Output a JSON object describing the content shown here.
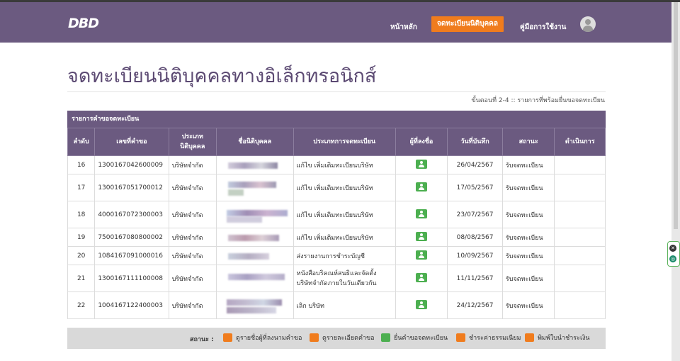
{
  "nav": {
    "logo": "DBD",
    "home": "หน้าหลัก",
    "register": "จดทะเบียนนิติบุคคล",
    "manual": "คู่มือการใช้งาน"
  },
  "page": {
    "title": "จดทะเบียนนิติบุคคลทางอิเล็กทรอนิกส์",
    "step": "ขั้นตอนที่ 2-4 :: รายการที่พร้อมยื่นขอจดทะเบียน"
  },
  "panel": {
    "title": "รายการคำขอจดทะเบียน",
    "headers": {
      "no": "ลำดับ",
      "request_no": "เลขที่คำขอ",
      "entity_type": "ประเภท นิติบุคคล",
      "entity_name": "ชื่อนิติบุคคล",
      "registration_type": "ประเภทการจดทะเบียน",
      "signer": "ผู้ที่ลงชื่อ",
      "saved_date": "วันที่บันทึก",
      "status": "สถานะ",
      "action": "ดำเนินการ"
    },
    "rows": [
      {
        "no": "16",
        "request_no": "1300167042600009",
        "entity_type": "บริษัทจำกัด",
        "registration_type": "แก้ไข เพิ่มเติมทะเบียนบริษัท",
        "saved_date": "26/04/2567",
        "status": "รับจดทะเบียน"
      },
      {
        "no": "17",
        "request_no": "1300167051700012",
        "entity_type": "บริษัทจำกัด",
        "registration_type": "แก้ไข เพิ่มเติมทะเบียนบริษัท",
        "saved_date": "17/05/2567",
        "status": "รับจดทะเบียน"
      },
      {
        "no": "18",
        "request_no": "4000167072300003",
        "entity_type": "บริษัทจำกัด",
        "registration_type": "แก้ไข เพิ่มเติมทะเบียนบริษัท",
        "saved_date": "23/07/2567",
        "status": "รับจดทะเบียน"
      },
      {
        "no": "19",
        "request_no": "7500167080800002",
        "entity_type": "บริษัทจำกัด",
        "registration_type": "แก้ไข เพิ่มเติมทะเบียนบริษัท",
        "saved_date": "08/08/2567",
        "status": "รับจดทะเบียน"
      },
      {
        "no": "20",
        "request_no": "1084167091000016",
        "entity_type": "บริษัทจำกัด",
        "registration_type": "ส่งรายงานการชำระบัญชี",
        "saved_date": "10/09/2567",
        "status": "รับจดทะเบียน"
      },
      {
        "no": "21",
        "request_no": "1300167111100008",
        "entity_type": "บริษัทจำกัด",
        "registration_type": "หนังสือบริคณห์สนธิและจัดตั้งบริษัทจำกัดภายในวันเดียวกัน",
        "saved_date": "11/11/2567",
        "status": "รับจดทะเบียน"
      },
      {
        "no": "22",
        "request_no": "1004167122400003",
        "entity_type": "บริษัทจำกัด",
        "registration_type": "เลิก บริษัท",
        "saved_date": "24/12/2567",
        "status": "รับจดทะเบียน"
      }
    ]
  },
  "footer": {
    "label": "สถานะ :",
    "legend": [
      {
        "text": "ดูรายชื่อผู้ที่ลงนามคำขอ",
        "color": "#f07c1d",
        "icon": "user-icon"
      },
      {
        "text": "ดูรายละเอียดคำขอ",
        "color": "#f07c1d",
        "icon": "document-icon"
      },
      {
        "text": "ยื่นคำขอจดทะเบียน",
        "color": "#4caf50",
        "icon": "send-icon"
      },
      {
        "text": "ชำระค่าธรรมเนียม",
        "color": "#f07c1d",
        "icon": "card-icon"
      },
      {
        "text": "พิมพ์ใบนำชำระเงิน",
        "color": "#f07c1d",
        "icon": "printer-icon"
      }
    ]
  },
  "colors": {
    "nav_bg": "#6b5a80",
    "accent": "#f07c1d",
    "success": "#4caf50",
    "title": "#5c4a73"
  }
}
